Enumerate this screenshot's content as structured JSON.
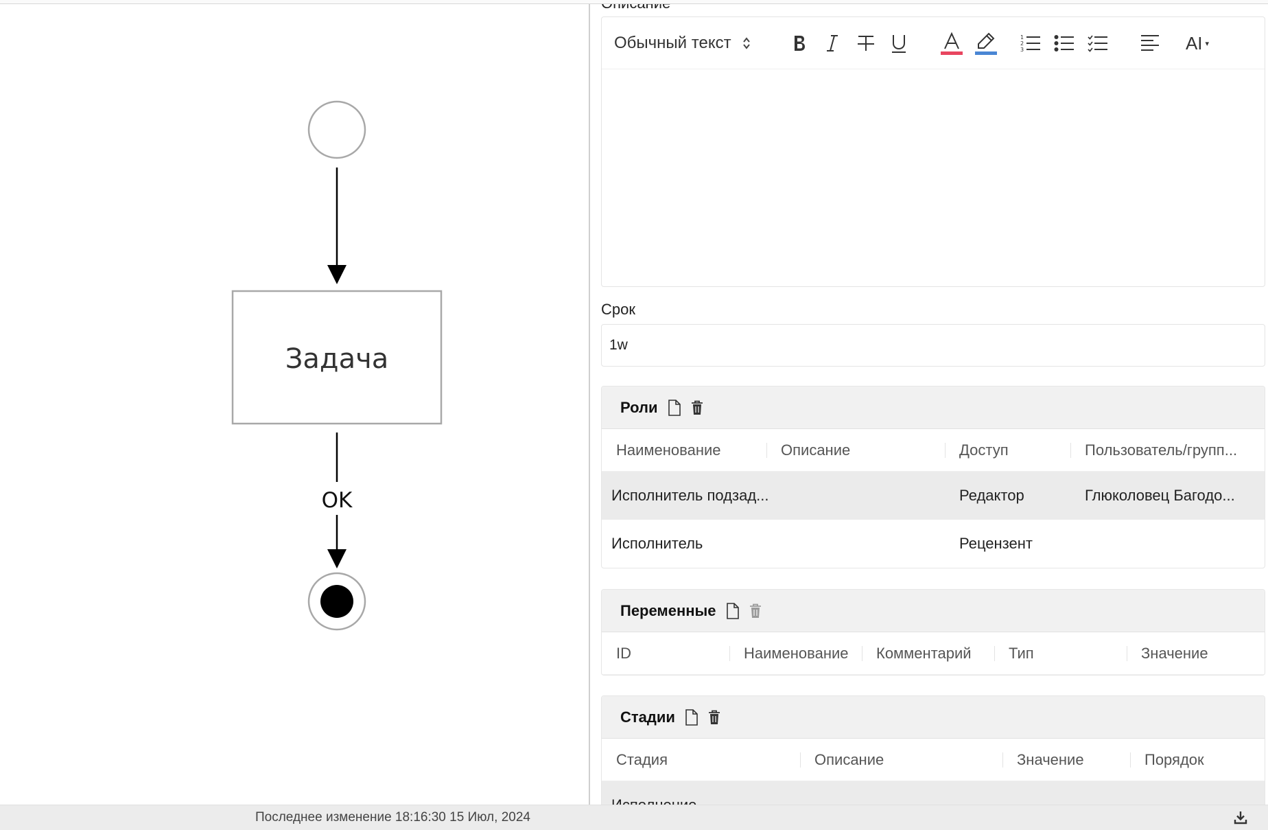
{
  "diagram": {
    "task_label": "Задача",
    "flow_label": "OK"
  },
  "description": {
    "label": "Описание",
    "block_type": "Обычный текст",
    "toolbar": {
      "ai_label": "AI"
    },
    "colors": {
      "text_color_bar": "#e8455f",
      "highlight_bar": "#4a86d4"
    }
  },
  "deadline": {
    "label": "Срок",
    "value": "1w"
  },
  "roles": {
    "title": "Роли",
    "columns": [
      "Наименование",
      "Описание",
      "Доступ",
      "Пользователь/групп..."
    ],
    "rows": [
      [
        "Исполнитель подзад...",
        "",
        "Редактор",
        "Глюколовец Багодо..."
      ],
      [
        "Исполнитель",
        "",
        "Рецензент",
        ""
      ]
    ]
  },
  "variables": {
    "title": "Переменные",
    "columns": [
      "ID",
      "Наименование",
      "Комментарий",
      "Тип",
      "Значение"
    ]
  },
  "stages": {
    "title": "Стадии",
    "columns": [
      "Стадия",
      "Описание",
      "Значение",
      "Порядок"
    ],
    "rows": [
      [
        "Исполнение",
        "",
        "",
        ""
      ]
    ]
  },
  "status": {
    "last_modified": "Последнее изменение 18:16:30 15 Июл, 2024"
  }
}
